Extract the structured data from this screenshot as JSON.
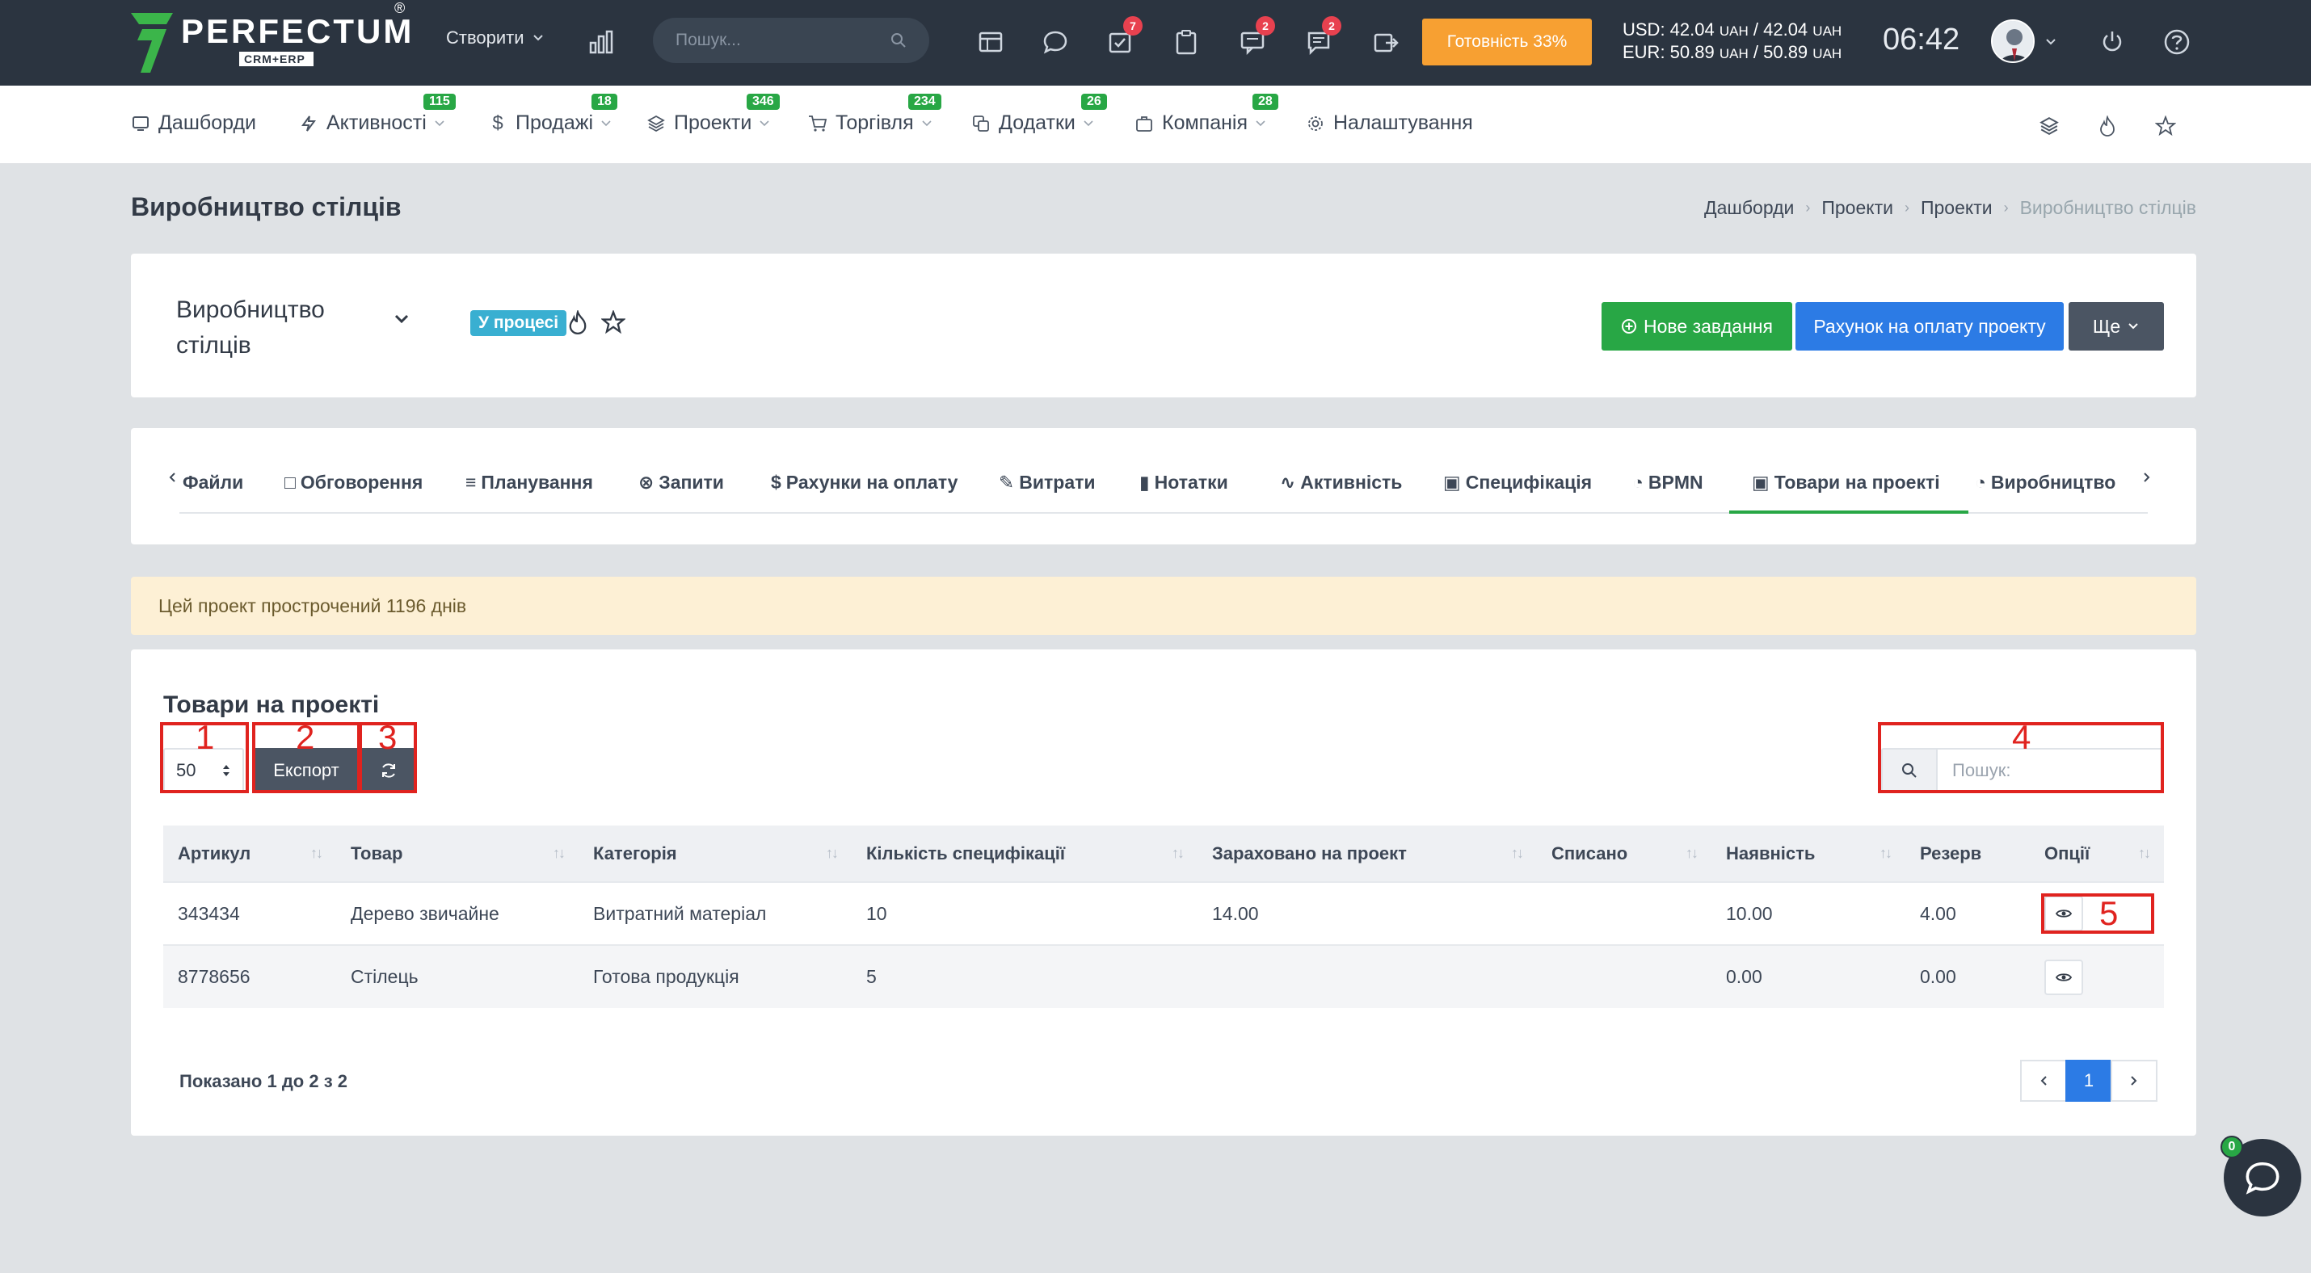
{
  "topbar": {
    "logo_name": "PERFECTUM",
    "logo_reg": "®",
    "logo_sub": "CRM+ERP",
    "create_label": "Створити",
    "search_placeholder": "Пошук...",
    "badges": {
      "tasks": "7",
      "chat": "2",
      "messages": "2"
    },
    "ready_label": "Готовність 33%",
    "rates": {
      "usd_label": "USD: 42.04",
      "usd_unit1": "UAH",
      "usd_sep": "/ 42.04",
      "usd_unit2": "UAH",
      "eur_label": "EUR: 50.89",
      "eur_unit1": "UAH",
      "eur_sep": "/ 50.89",
      "eur_unit2": "UAH"
    },
    "clock": "06:42"
  },
  "nav": {
    "items": [
      {
        "label": "Дашборди",
        "badge": ""
      },
      {
        "label": "Активності",
        "badge": "115"
      },
      {
        "label": "Продажі",
        "badge": "18"
      },
      {
        "label": "Проекти",
        "badge": "346"
      },
      {
        "label": "Торгівля",
        "badge": "234"
      },
      {
        "label": "Додатки",
        "badge": "26"
      },
      {
        "label": "Компанія",
        "badge": "28"
      },
      {
        "label": "Налаштування",
        "badge": ""
      }
    ]
  },
  "page": {
    "title": "Виробництво стілців",
    "breadcrumb": [
      "Дашборди",
      "Проекти",
      "Проекти",
      "Виробництво стілців"
    ]
  },
  "project": {
    "name": "Виробництво стілців",
    "status": "У процесі",
    "btn_new_task": "Нове завдання",
    "btn_invoice": "Рахунок на оплату проекту",
    "btn_more": "Ще"
  },
  "tabs": {
    "items": [
      "Файли",
      "Обговорення",
      "Планування",
      "Запити",
      "Рахунки на оплату",
      "Витрати",
      "Нотатки",
      "Активність",
      "Специфікація",
      "BPMN",
      "Товари на проекті",
      "Виробництво"
    ],
    "active": "Товари на проекті"
  },
  "alert": {
    "text": "Цей проект прострочений 1196 днів"
  },
  "table_section": {
    "title": "Товари на проекті",
    "page_length": "50",
    "export_label": "Експорт",
    "search_placeholder": "Пошук:",
    "columns": [
      "Артикул",
      "Товар",
      "Категорія",
      "Кількість специфікації",
      "Зараховано на проект",
      "Списано",
      "Наявність",
      "Резерв",
      "Опції"
    ],
    "rows": [
      [
        "343434",
        "Дерево звичайне",
        "Витратний матеріал",
        "10",
        "14.00",
        "",
        "10.00",
        "4.00"
      ],
      [
        "8778656",
        "Стілець",
        "Готова продукція",
        "5",
        "",
        "",
        "0.00",
        "0.00"
      ]
    ],
    "info": "Показано 1 до 2 з 2",
    "current_page": "1"
  },
  "annotations": [
    "1",
    "2",
    "3",
    "4",
    "5"
  ],
  "chat": {
    "badge": "0"
  },
  "colors": {
    "accent_green": "#28a745",
    "primary_blue": "#2c7be5",
    "warning_orange": "#f7a032",
    "status_cyan": "#39afd1",
    "annotation_red": "#e0231f"
  }
}
